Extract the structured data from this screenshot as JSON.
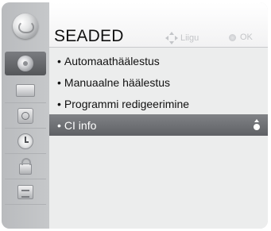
{
  "header": {
    "title": "SEADED",
    "hint_move": "Liigu",
    "hint_ok": "OK"
  },
  "sidebar": {
    "items": [
      {
        "icon": "setup-disc-icon",
        "active": true
      },
      {
        "icon": "picture-tv-icon",
        "active": false
      },
      {
        "icon": "audio-speaker-icon",
        "active": false
      },
      {
        "icon": "time-clock-icon",
        "active": false
      },
      {
        "icon": "lock-icon",
        "active": false
      },
      {
        "icon": "option-icon",
        "active": false
      }
    ]
  },
  "menu": {
    "items": [
      {
        "label": "Automaathäälestus"
      },
      {
        "label": "Manuaalne häälestus"
      },
      {
        "label": "Programmi redigeerimine"
      },
      {
        "label": "CI info",
        "selected": true
      }
    ]
  },
  "colors": {
    "selected_bg": "#6f7175",
    "panel_bg": "#eceded",
    "sidebar_bg": "#c0c2c4"
  }
}
